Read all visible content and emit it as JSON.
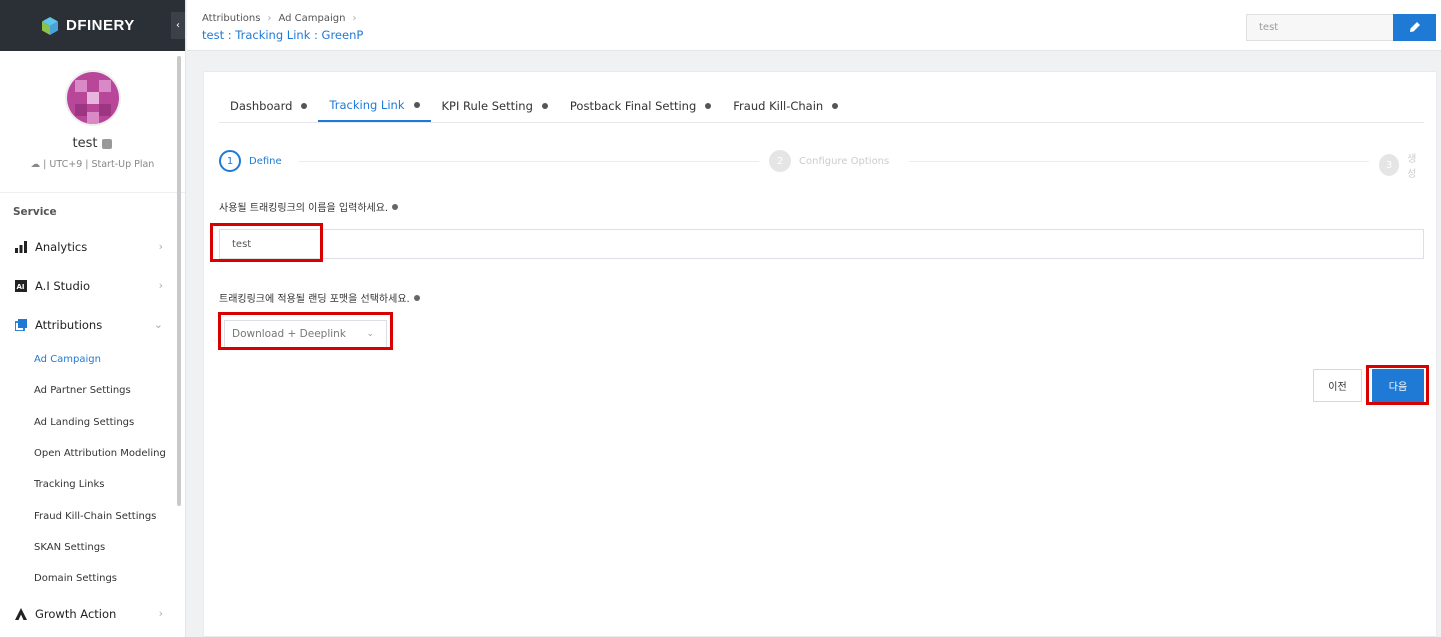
{
  "app": {
    "logo_text": "DFINERY",
    "collapse_icon": "chevron-left-icon"
  },
  "profile": {
    "name": "test",
    "meta": "☁ | UTC+9 | Start-Up Plan"
  },
  "sidebar": {
    "section_label": "Service",
    "items": [
      {
        "label": "Analytics",
        "icon": "bar-chart-icon"
      },
      {
        "label": "A.I Studio",
        "icon": "ai-icon"
      },
      {
        "label": "Attributions",
        "icon": "attributions-icon",
        "expanded": true
      },
      {
        "label": "Growth Action",
        "icon": "growth-icon"
      }
    ],
    "sub_items": [
      {
        "label": "Ad Campaign",
        "active": true
      },
      {
        "label": "Ad Partner Settings"
      },
      {
        "label": "Ad Landing Settings"
      },
      {
        "label": "Open Attribution Modeling"
      },
      {
        "label": "Tracking Links"
      },
      {
        "label": "Fraud Kill-Chain Settings"
      },
      {
        "label": "SKAN Settings"
      },
      {
        "label": "Domain Settings"
      }
    ]
  },
  "header": {
    "breadcrumb": [
      "Attributions",
      "Ad Campaign"
    ],
    "title": "test : Tracking Link : GreenP",
    "search_value": "test",
    "edit_icon": "pencil-icon"
  },
  "tabs": [
    {
      "label": "Dashboard",
      "active": false
    },
    {
      "label": "Tracking Link",
      "active": true
    },
    {
      "label": "KPI Rule Setting",
      "active": false
    },
    {
      "label": "Postback Final Setting",
      "active": false
    },
    {
      "label": "Fraud Kill-Chain",
      "active": false
    }
  ],
  "steps": [
    {
      "number": "1",
      "label": "Define",
      "active": true
    },
    {
      "number": "2",
      "label": "Configure Options",
      "active": false
    },
    {
      "number": "3",
      "label": "생성",
      "active": false
    }
  ],
  "form": {
    "name_label": "사용될 트래킹링크의 이름을 입력하세요.",
    "name_value": "test",
    "format_label": "트래킹링크에 적용될 랜딩 포맷을 선택하세요.",
    "format_value": "Download + Deeplink"
  },
  "actions": {
    "prev_label": "이전",
    "next_label": "다음"
  },
  "colors": {
    "accent": "#1f7ad6",
    "highlight": "#d90000",
    "logo_bar": "#2b2f36"
  }
}
